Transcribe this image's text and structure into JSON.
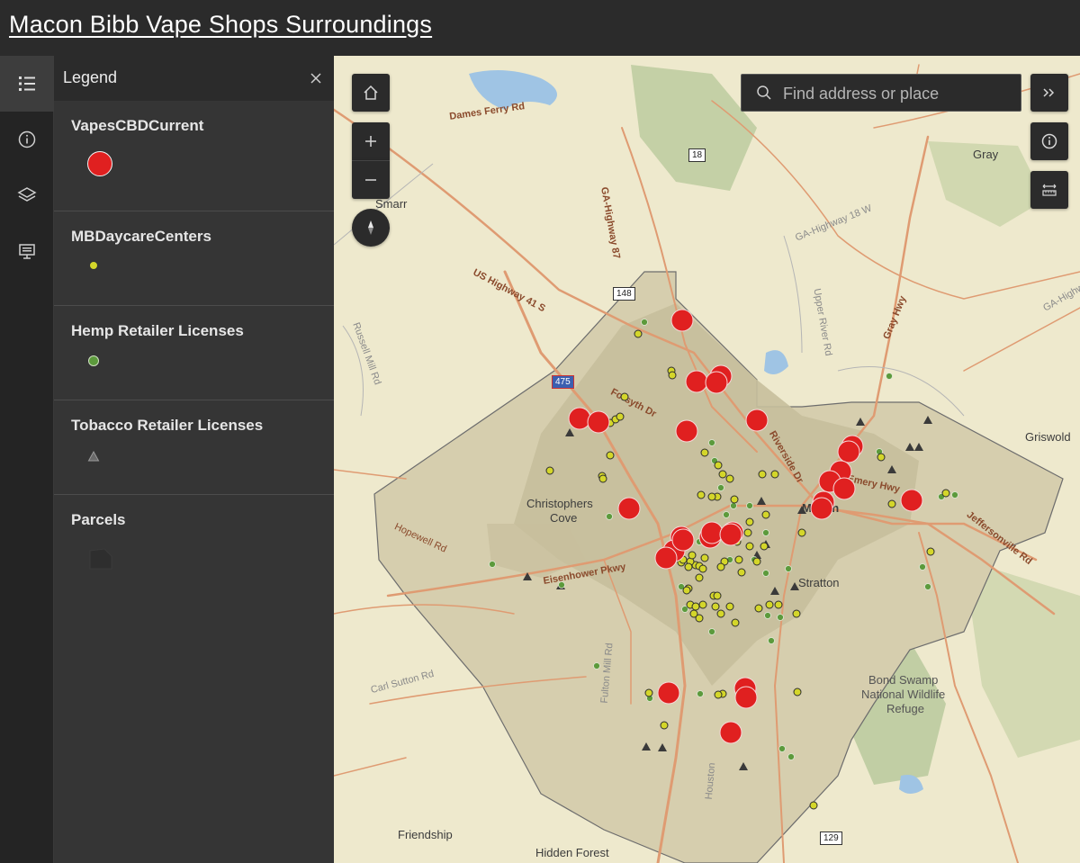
{
  "app": {
    "title": "Macon Bibb Vape Shops Surroundings"
  },
  "rail": {
    "items": [
      "legend",
      "details",
      "layers",
      "basemap"
    ]
  },
  "legend": {
    "title": "Legend",
    "close_label": "×",
    "layers": [
      {
        "name": "VapesCBDCurrent",
        "symbol": "red-circle",
        "color": "#e02020"
      },
      {
        "name": "MBDaycareCenters",
        "symbol": "yellow-dot",
        "color": "#d4d62a"
      },
      {
        "name": "Hemp Retailer Licenses",
        "symbol": "green-dot",
        "color": "#5c9a3c"
      },
      {
        "name": "Tobacco Retailer Licenses",
        "symbol": "gray-triangle",
        "color": "#6a6a6a"
      },
      {
        "name": "Parcels",
        "symbol": "parcel-polygon",
        "color": "#2a2a2a"
      }
    ]
  },
  "map": {
    "search": {
      "placeholder": "Find address or place"
    },
    "labels": {
      "places": [
        "Smarr",
        "Gray",
        "Griswold",
        "Christophers",
        "Cove",
        "Stratton",
        "Macon",
        "Bond Swamp",
        "National Wildlife",
        "Refuge",
        "Friendship",
        "Hidden Forest"
      ],
      "roads": [
        "Dames Ferry Rd",
        "GA-Highway 87",
        "US Highway 41 S",
        "Forsyth Dr",
        "Riverside Dr",
        "Gray Hwy",
        "Jeffersonville Rd",
        "Eisenhower Pkwy",
        "Hopewell Rd",
        "Fulton Mill Rd",
        "Carl Sutton Rd",
        "Houston",
        "Emery Hwy",
        "GA-Highway 18 W",
        "Upper River Rd",
        "Russell Mill Rd",
        "GA-Highway"
      ],
      "shields": [
        "18",
        "148",
        "475",
        "129"
      ]
    },
    "colors": {
      "county": "#d6ceae",
      "urban": "#c7bf9c",
      "forest": "#b9c99c",
      "water": "#9fc4e4",
      "roads": "#df9b72"
    }
  }
}
